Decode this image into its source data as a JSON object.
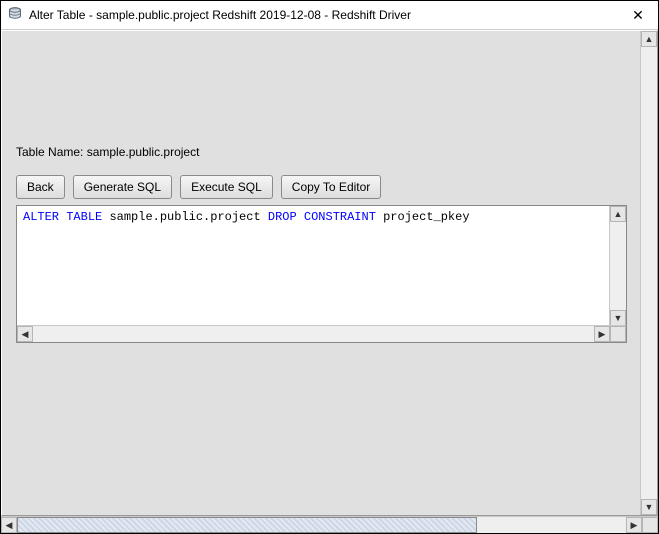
{
  "window": {
    "title": "Alter Table - sample.public.project Redshift 2019-12-08 - Redshift Driver"
  },
  "main": {
    "table_label": "Table Name: sample.public.project",
    "buttons": {
      "back": "Back",
      "generate": "Generate SQL",
      "execute": "Execute SQL",
      "copy": "Copy To Editor"
    },
    "sql": {
      "kw_alter": "ALTER",
      "kw_table": "TABLE",
      "ident1": "sample.public.project",
      "kw_drop": "DROP",
      "kw_constraint": "CONSTRAINT",
      "ident2": "project_pkey"
    }
  }
}
